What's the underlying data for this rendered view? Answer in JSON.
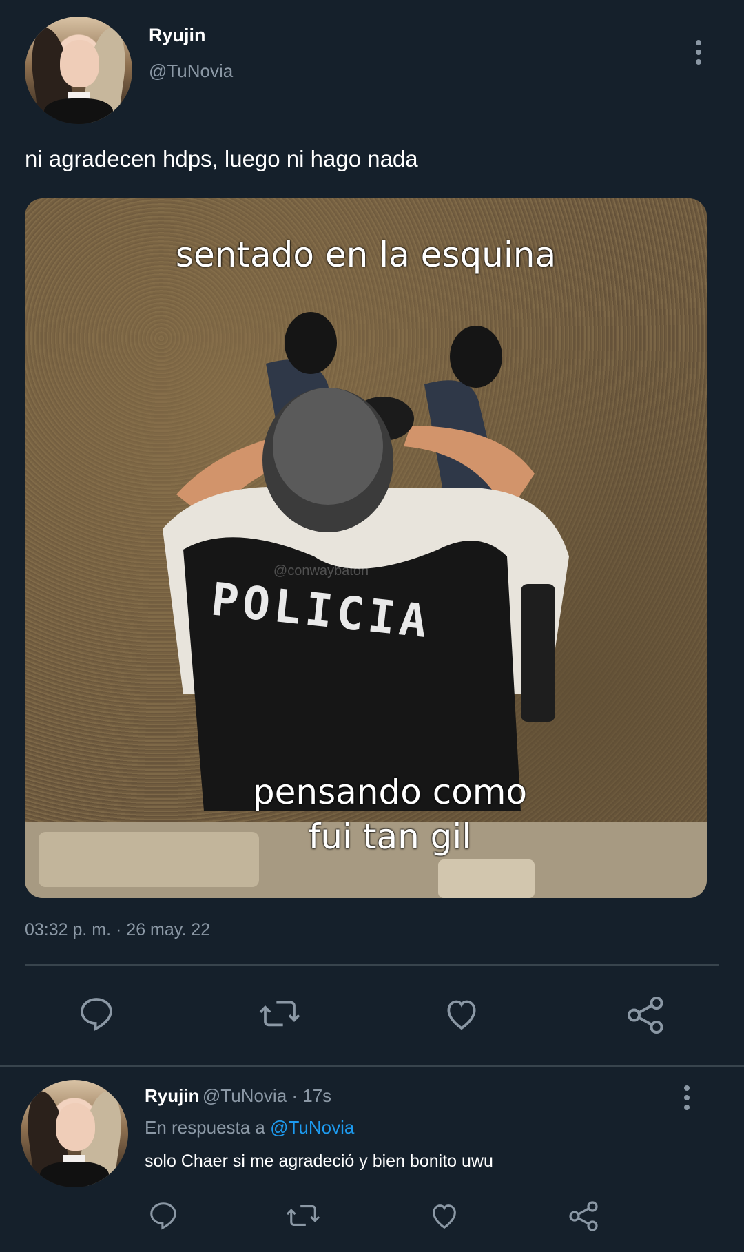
{
  "tweet": {
    "author_name": "Ryujin",
    "author_handle": "@TuNovia",
    "text": "ni agradecen hdps, luego ni hago nada",
    "media": {
      "caption_top": "sentado en la esquina",
      "caption_bottom": "pensando como fui tan gil",
      "vest_text": "POLICIA",
      "watermark": "@conwaybaton"
    },
    "timestamp": "03:32 p. m. · 26 may. 22"
  },
  "actions": {
    "icons": [
      "reply-icon",
      "retweet-icon",
      "like-icon",
      "share-icon"
    ]
  },
  "reply": {
    "author_name": "Ryujin",
    "author_handle_time": "@TuNovia · 17s",
    "reply_prefix": "En respuesta a",
    "reply_to": "@TuNovia",
    "text": "solo Chaer si me agradeció y bien bonito uwu"
  },
  "colors": {
    "background": "#15202b",
    "secondary_text": "#8b98a5",
    "accent": "#1d9bf0",
    "divider": "#38444d"
  }
}
